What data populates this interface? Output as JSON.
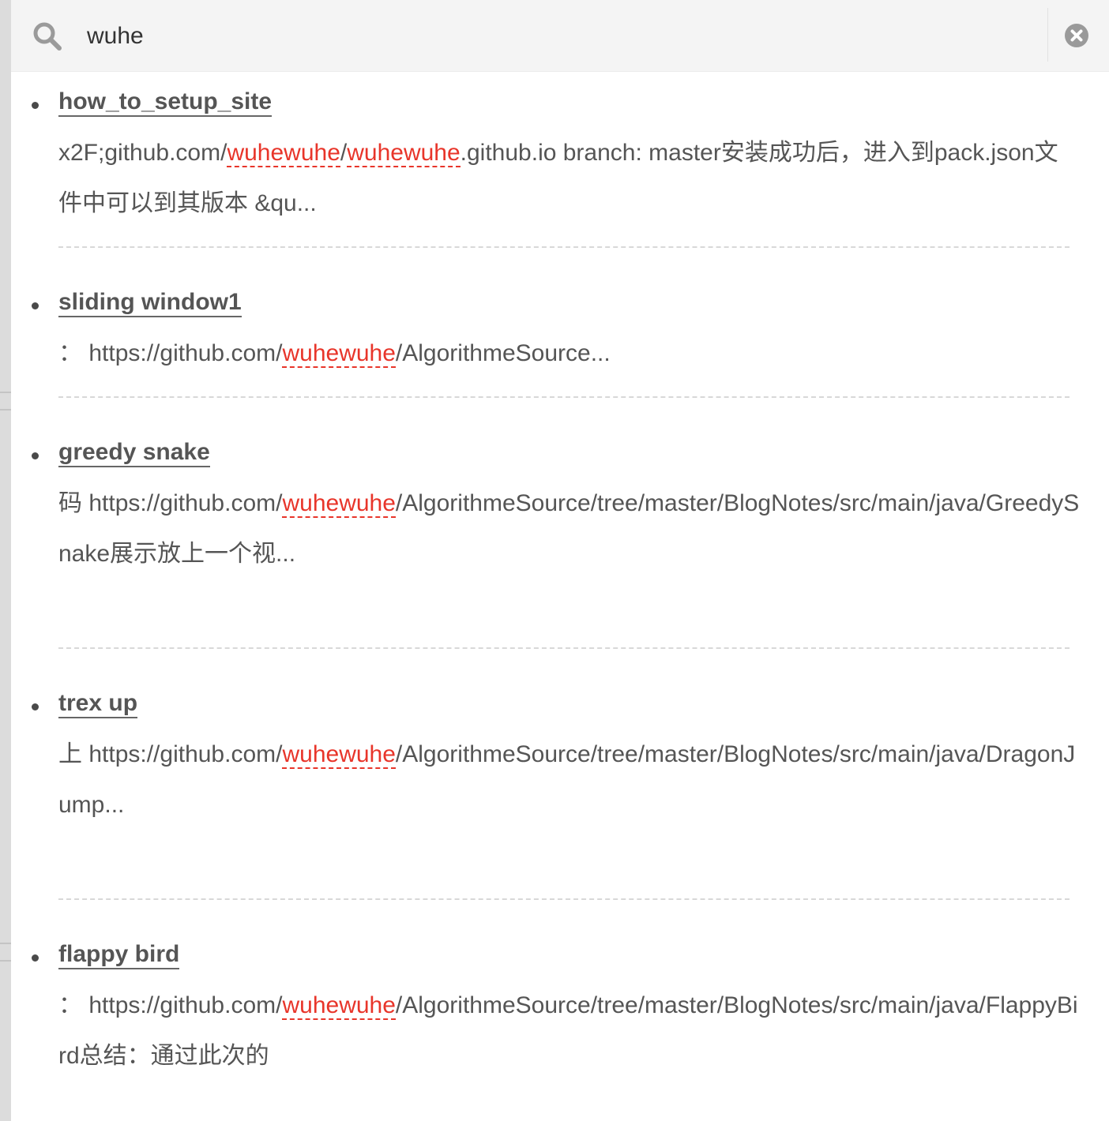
{
  "search": {
    "query": "wuhe",
    "icon": "search-icon",
    "clear_icon": "close-icon"
  },
  "colors": {
    "highlight": "#e8352a",
    "text": "#555555",
    "search_bar_bg": "#f4f4f4"
  },
  "results": [
    {
      "title": "how_to_setup_site",
      "excerpt": [
        {
          "t": "x2F;github.com/"
        },
        {
          "t": "wuhewuhe",
          "hl": true
        },
        {
          "t": "/"
        },
        {
          "t": "wuhewuhe",
          "hl": true
        },
        {
          "t": ".github.io branch: master安装成功后，进入到pack.json文件中可以到其版本 &qu..."
        }
      ]
    },
    {
      "title": "sliding window1",
      "excerpt": [
        {
          "t": "： https://github.com/"
        },
        {
          "t": "wuhewuhe",
          "hl": true
        },
        {
          "t": "/AlgorithmeSource..."
        }
      ]
    },
    {
      "title": "greedy snake",
      "excerpt": [
        {
          "t": "码 https://github.com/"
        },
        {
          "t": "wuhewuhe",
          "hl": true
        },
        {
          "t": "/AlgorithmeSource/tree/master/BlogNotes/src/main/java/GreedySnake展示放上一个视..."
        }
      ]
    },
    {
      "title": "trex up",
      "excerpt": [
        {
          "t": "上 https://github.com/"
        },
        {
          "t": "wuhewuhe",
          "hl": true
        },
        {
          "t": "/AlgorithmeSource/tree/master/BlogNotes/src/main/java/DragonJump..."
        }
      ]
    },
    {
      "title": "flappy bird",
      "excerpt": [
        {
          "t": "： https://github.com/"
        },
        {
          "t": "wuhewuhe",
          "hl": true
        },
        {
          "t": "/AlgorithmeSource/tree/master/BlogNotes/src/main/java/FlappyBird总结：通过此次的"
        }
      ]
    }
  ]
}
